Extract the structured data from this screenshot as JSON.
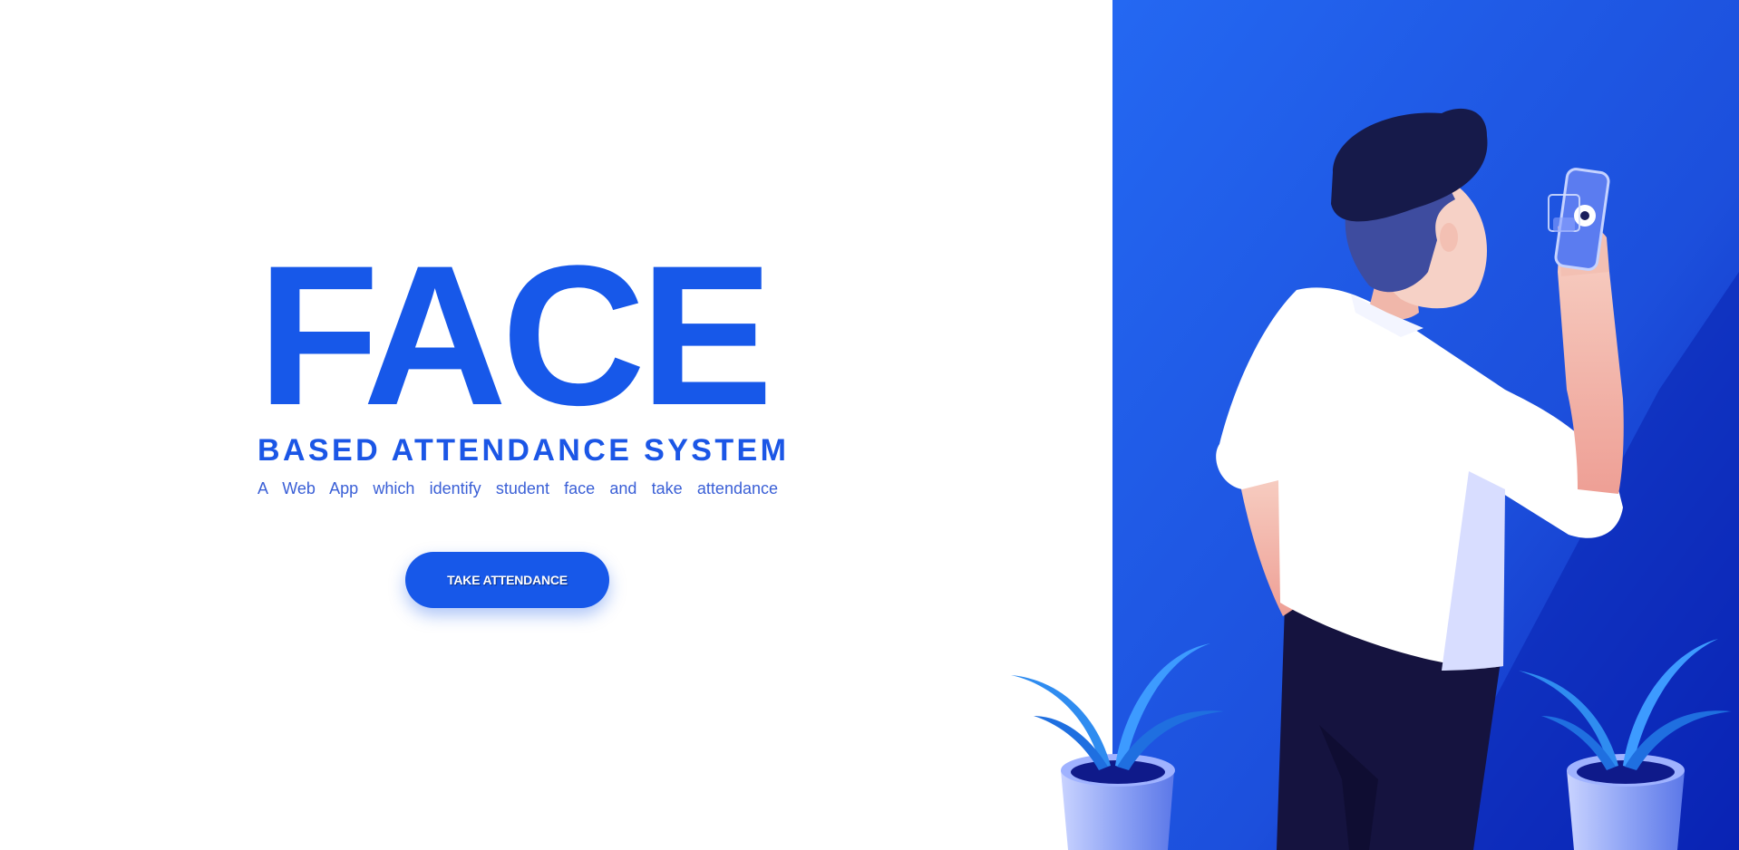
{
  "hero": {
    "title": "FACE",
    "subtitle": "BASED ATTENDANCE SYSTEM",
    "tagline": "A Web App which identify student face and take attendance"
  },
  "cta": {
    "label": "TAKE ATTENDANCE"
  },
  "colors": {
    "accent": "#1758e9",
    "panel_top": "#2266ef",
    "panel_bottom": "#0e2fc7",
    "hair": "#161a4a",
    "pants": "#15133f",
    "shirt": "#ffffff",
    "skin": "#f3c4b6",
    "leaf": "#2f8cf0"
  },
  "illustration": {
    "icons": [
      "person-illustration",
      "phone-icon",
      "face-scan-icon",
      "plant-pot-left",
      "plant-pot-right"
    ]
  }
}
